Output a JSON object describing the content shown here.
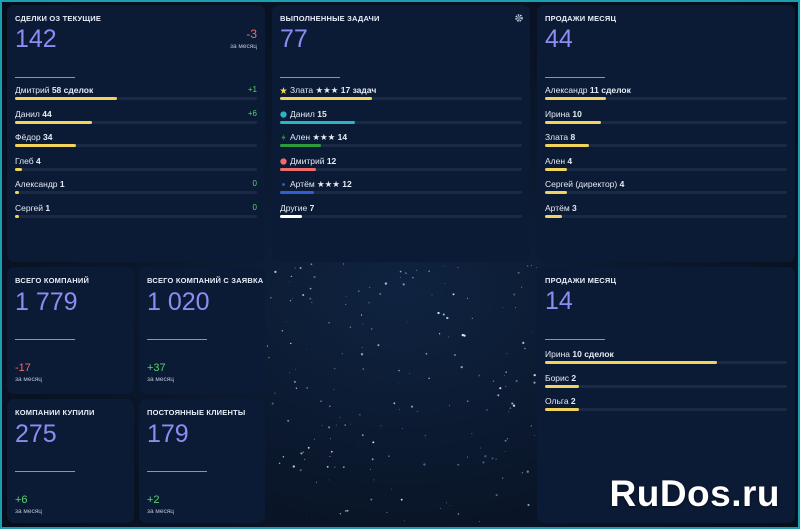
{
  "colors": {
    "accent": "#8e8cf2",
    "positive": "#56d46b",
    "negative": "#f26b6b",
    "bar_yellow": "#f2d45c"
  },
  "deals": {
    "title": "Сделки оз текущие",
    "value": "142",
    "change": "-3",
    "change_caption": "за месяц",
    "rows": [
      {
        "name": "Дмитрий",
        "count": "58 сделок",
        "delta": "+1",
        "fill": 0.42
      },
      {
        "name": "Данил",
        "count": "44",
        "delta": "+6",
        "fill": 0.32
      },
      {
        "name": "Фёдор",
        "count": "34",
        "delta": "",
        "fill": 0.25
      },
      {
        "name": "Глеб",
        "count": "4",
        "delta": "",
        "fill": 0.03
      },
      {
        "name": "Александр",
        "count": "1",
        "delta": "0",
        "fill": 0.01
      },
      {
        "name": "Сергей",
        "count": "1",
        "delta": "0",
        "fill": 0.01
      }
    ]
  },
  "tasks": {
    "title": "Выполненные задачи",
    "value": "77",
    "rows": [
      {
        "name": "Злата ★★★",
        "count": "17 задач",
        "icon": "star-icon",
        "color": "#f2d45c",
        "fill": 0.38
      },
      {
        "name": "Данил",
        "count": "15",
        "icon": "circle-icon",
        "color": "#2cb3c4",
        "fill": 0.31
      },
      {
        "name": "Ален ★★★",
        "count": "14",
        "icon": "bolt-icon",
        "color": "#2c9b3a",
        "fill": 0.17
      },
      {
        "name": "Дмитрий",
        "count": "12",
        "icon": "circle-icon",
        "color": "#f26b6b",
        "fill": 0.15
      },
      {
        "name": "Артём ★★★",
        "count": "12",
        "icon": "dot-icon",
        "color": "#2f5fd0",
        "fill": 0.14
      },
      {
        "name": "Другие",
        "count": "7",
        "icon": "",
        "color": "#ffffff",
        "fill": 0.09
      }
    ]
  },
  "sales1": {
    "title": "Продажи месяц",
    "value": "44",
    "rows": [
      {
        "name": "Александр",
        "count": "11 сделок",
        "fill": 0.25
      },
      {
        "name": "Ирина",
        "count": "10",
        "fill": 0.23
      },
      {
        "name": "Злата",
        "count": "8",
        "fill": 0.18
      },
      {
        "name": "Ален",
        "count": "4",
        "fill": 0.09
      },
      {
        "name": "Сергей (директор)",
        "count": "4",
        "fill": 0.09
      },
      {
        "name": "Артём",
        "count": "3",
        "fill": 0.07
      }
    ]
  },
  "companies_total": {
    "title": "Всего компаний",
    "value": "1 779",
    "delta": "-17",
    "caption": "за месяц"
  },
  "companies_request": {
    "title": "Всего компаний с заявка",
    "value": "1 020",
    "delta": "+37",
    "caption": "за месяц"
  },
  "companies_bought": {
    "title": "Компании купили",
    "value": "275",
    "delta": "+6",
    "caption": "за месяц"
  },
  "regular_clients": {
    "title": "Постоянные клиенты",
    "value": "179",
    "delta": "+2",
    "caption": "за месяц"
  },
  "sales2": {
    "title": "Продажи месяц",
    "value": "14",
    "rows": [
      {
        "name": "Ирина",
        "count": "10 сделок",
        "fill": 0.71
      },
      {
        "name": "Борис",
        "count": "2",
        "fill": 0.14
      },
      {
        "name": "Ольга",
        "count": "2",
        "fill": 0.14
      }
    ]
  },
  "watermark": "RuDos.ru"
}
